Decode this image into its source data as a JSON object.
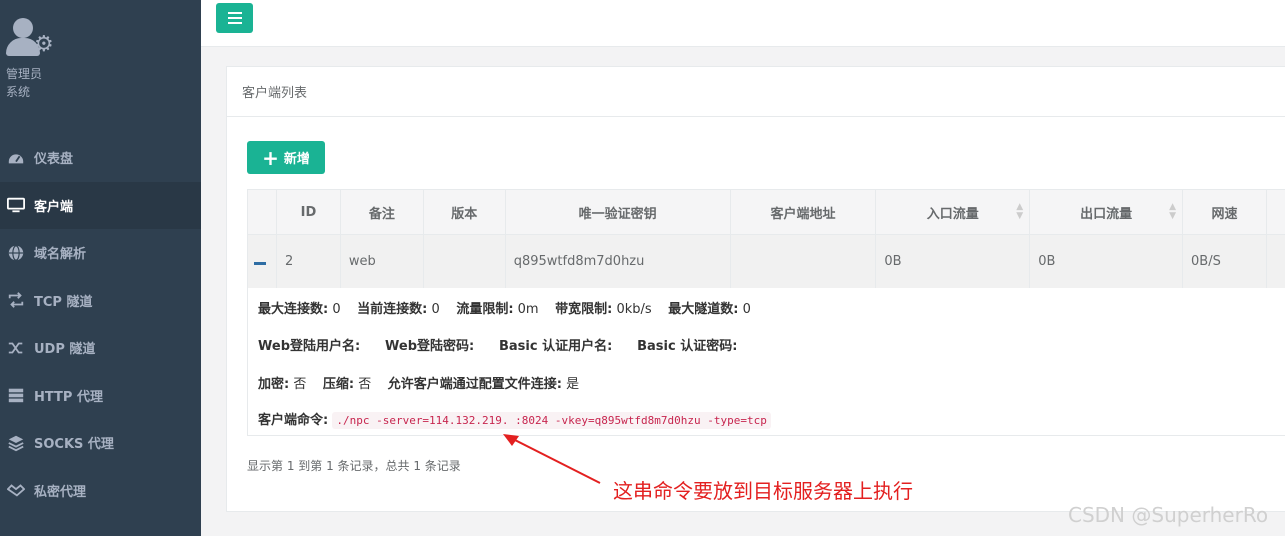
{
  "sidebar": {
    "profile": {
      "name": "管理员",
      "role": "系统"
    },
    "items": [
      {
        "label": "仪表盘",
        "icon": "dashboard-icon"
      },
      {
        "label": "客户端",
        "icon": "monitor-icon",
        "active": true
      },
      {
        "label": "域名解析",
        "icon": "globe-icon"
      },
      {
        "label": "TCP 隧道",
        "icon": "retweet-icon"
      },
      {
        "label": "UDP 隧道",
        "icon": "shuffle-icon"
      },
      {
        "label": "HTTP 代理",
        "icon": "server-icon"
      },
      {
        "label": "SOCKS 代理",
        "icon": "layers-icon"
      },
      {
        "label": "私密代理",
        "icon": "handshake-icon"
      }
    ]
  },
  "panel": {
    "title": "客户端列表",
    "add_label": "新增"
  },
  "table": {
    "columns": [
      "ID",
      "备注",
      "版本",
      "唯一验证密钥",
      "客户端地址",
      "入口流量",
      "出口流量",
      "网速"
    ],
    "rows": [
      {
        "id": "2",
        "remark": "web",
        "version": "",
        "vkey": "q895wtfd8m7d0hzu",
        "address": "",
        "in_flow": "0B",
        "out_flow": "0B",
        "speed": "0B/S"
      }
    ]
  },
  "detail": {
    "max_conn_label": "最大连接数:",
    "max_conn": "0",
    "cur_conn_label": "当前连接数:",
    "cur_conn": "0",
    "flow_limit_label": "流量限制:",
    "flow_limit": "0m",
    "bw_limit_label": "带宽限制:",
    "bw_limit": "0kb/s",
    "max_tunnel_label": "最大隧道数:",
    "max_tunnel": "0",
    "web_user_label": "Web登陆用户名:",
    "web_pass_label": "Web登陆密码:",
    "basic_user_label": "Basic 认证用户名:",
    "basic_pass_label": "Basic 认证密码:",
    "encrypt_label": "加密:",
    "encrypt": "否",
    "compress_label": "压缩:",
    "compress": "否",
    "config_conn_label": "允许客户端通过配置文件连接:",
    "config_conn": "是",
    "cmd_label": "客户端命令:",
    "cmd": "./npc -server=114.132.219.  :8024 -vkey=q895wtfd8m7d0hzu -type=tcp"
  },
  "page_info": "显示第 1 到第 1 条记录，总共 1 条记录",
  "annotation": "这串命令要放到目标服务器上执行",
  "watermark": "CSDN @SuperherRo",
  "colors": {
    "sidebar": "#2f4050",
    "accent": "#1ab394",
    "annotation": "#e32020",
    "cmd": "#c7254e"
  }
}
